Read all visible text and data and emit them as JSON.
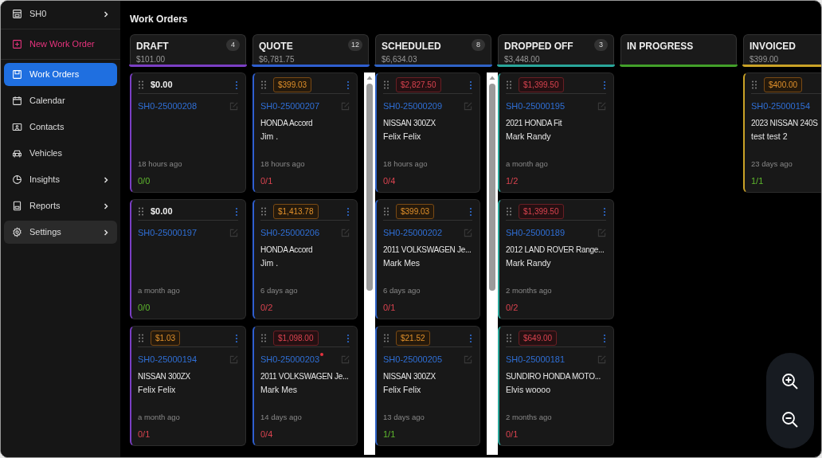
{
  "sidebar": {
    "items": [
      {
        "label": "SH0",
        "kind": "shop",
        "chevron": true,
        "selected": false,
        "hovered": false
      },
      {
        "label": "New Work Order",
        "kind": "action",
        "chevron": false,
        "selected": false,
        "hovered": false
      },
      {
        "label": "Work Orders",
        "kind": "nav",
        "chevron": false,
        "selected": true,
        "hovered": false
      },
      {
        "label": "Calendar",
        "kind": "nav",
        "chevron": false,
        "selected": false,
        "hovered": false
      },
      {
        "label": "Contacts",
        "kind": "nav",
        "chevron": false,
        "selected": false,
        "hovered": false
      },
      {
        "label": "Vehicles",
        "kind": "nav",
        "chevron": false,
        "selected": false,
        "hovered": false
      },
      {
        "label": "Insights",
        "kind": "nav",
        "chevron": true,
        "selected": false,
        "hovered": false
      },
      {
        "label": "Reports",
        "kind": "nav",
        "chevron": true,
        "selected": false,
        "hovered": false
      },
      {
        "label": "Settings",
        "kind": "nav",
        "chevron": true,
        "selected": false,
        "hovered": true
      }
    ]
  },
  "page_title": "Work Orders",
  "columns": [
    {
      "name": "DRAFT",
      "total": "$101.00",
      "count": "4",
      "color": "#7b3fc4",
      "scrollbar": false,
      "cards": [
        {
          "amount": "$0.00",
          "kind": "plain",
          "number": "SH0-25000208",
          "flagged": false,
          "age": "18 hours ago",
          "progress": "0/0",
          "complete": true
        },
        {
          "amount": "$0.00",
          "kind": "plain",
          "number": "SH0-25000197",
          "flagged": false,
          "age": "a month ago",
          "progress": "0/0",
          "complete": true
        },
        {
          "amount": "$1.03",
          "kind": "warning",
          "number": "SH0-25000194",
          "flagged": false,
          "vehicle": "NISSAN 300ZX",
          "customer": "Felix Felix",
          "age": "a month ago",
          "progress": "0/1",
          "complete": false
        }
      ]
    },
    {
      "name": "QUOTE",
      "total": "$6,781.75",
      "count": "12",
      "color": "#2f5fd0",
      "scrollbar": true,
      "cards": [
        {
          "amount": "$399.03",
          "kind": "warning",
          "number": "SH0-25000207",
          "flagged": false,
          "vehicle": "HONDA Accord",
          "customer": "Jim .",
          "age": "18 hours ago",
          "progress": "0/1",
          "complete": false
        },
        {
          "amount": "$1,413.78",
          "kind": "warning",
          "number": "SH0-25000206",
          "flagged": false,
          "vehicle": "HONDA Accord",
          "customer": "Jim .",
          "age": "6 days ago",
          "progress": "0/2",
          "complete": false
        },
        {
          "amount": "$1,098.00",
          "kind": "danger",
          "number": "SH0-25000203",
          "flagged": true,
          "vehicle": "2011 VOLKSWAGEN Je...",
          "customer": "Mark Mes",
          "age": "14 days ago",
          "progress": "0/4",
          "complete": false
        }
      ]
    },
    {
      "name": "SCHEDULED",
      "total": "$6,634.03",
      "count": "8",
      "color": "#2f63c7",
      "scrollbar": true,
      "cards": [
        {
          "amount": "$2,827.50",
          "kind": "danger",
          "number": "SH0-25000209",
          "flagged": false,
          "vehicle": "NISSAN 300ZX",
          "customer": "Felix Felix",
          "age": "18 hours ago",
          "progress": "0/4",
          "complete": false
        },
        {
          "amount": "$399.03",
          "kind": "warning",
          "number": "SH0-25000202",
          "flagged": false,
          "vehicle": "2011 VOLKSWAGEN Je...",
          "customer": "Mark Mes",
          "age": "6 days ago",
          "progress": "0/1",
          "complete": false
        },
        {
          "amount": "$21.52",
          "kind": "warning",
          "number": "SH0-25000205",
          "flagged": false,
          "vehicle": "NISSAN 300ZX",
          "customer": "Felix Felix",
          "age": "13 days ago",
          "progress": "1/1",
          "complete": true
        }
      ]
    },
    {
      "name": "DROPPED OFF",
      "total": "$3,448.00",
      "count": "3",
      "color": "#2aa79b",
      "scrollbar": false,
      "cards": [
        {
          "amount": "$1,399.50",
          "kind": "danger",
          "number": "SH0-25000195",
          "flagged": false,
          "vehicle": "2021 HONDA Fit",
          "customer": "Mark Randy",
          "age": "a month ago",
          "progress": "1/2",
          "complete": false
        },
        {
          "amount": "$1,399.50",
          "kind": "danger",
          "number": "SH0-25000189",
          "flagged": false,
          "vehicle": "2012 LAND ROVER Range...",
          "customer": "Mark Randy",
          "age": "2 months ago",
          "progress": "0/2",
          "complete": false
        },
        {
          "amount": "$649.00",
          "kind": "danger",
          "number": "SH0-25000181",
          "flagged": false,
          "vehicle": "SUNDIRO HONDA MOTO...",
          "customer": "Elvis woooo",
          "age": "2 months ago",
          "progress": "0/1",
          "complete": false
        }
      ]
    },
    {
      "name": "IN PROGRESS",
      "color": "#43a02a",
      "scrollbar": false
    },
    {
      "name": "INVOICED",
      "total": "$399.00",
      "color": "#c9a227",
      "scrollbar": false,
      "cards": [
        {
          "amount": "$400.00",
          "kind": "warning",
          "number": "SH0-25000154",
          "flagged": false,
          "vehicle": "2023 NISSAN 240S",
          "customer": "test test 2",
          "age": "23 days ago",
          "progress": "1/1",
          "complete": true
        }
      ]
    }
  ]
}
